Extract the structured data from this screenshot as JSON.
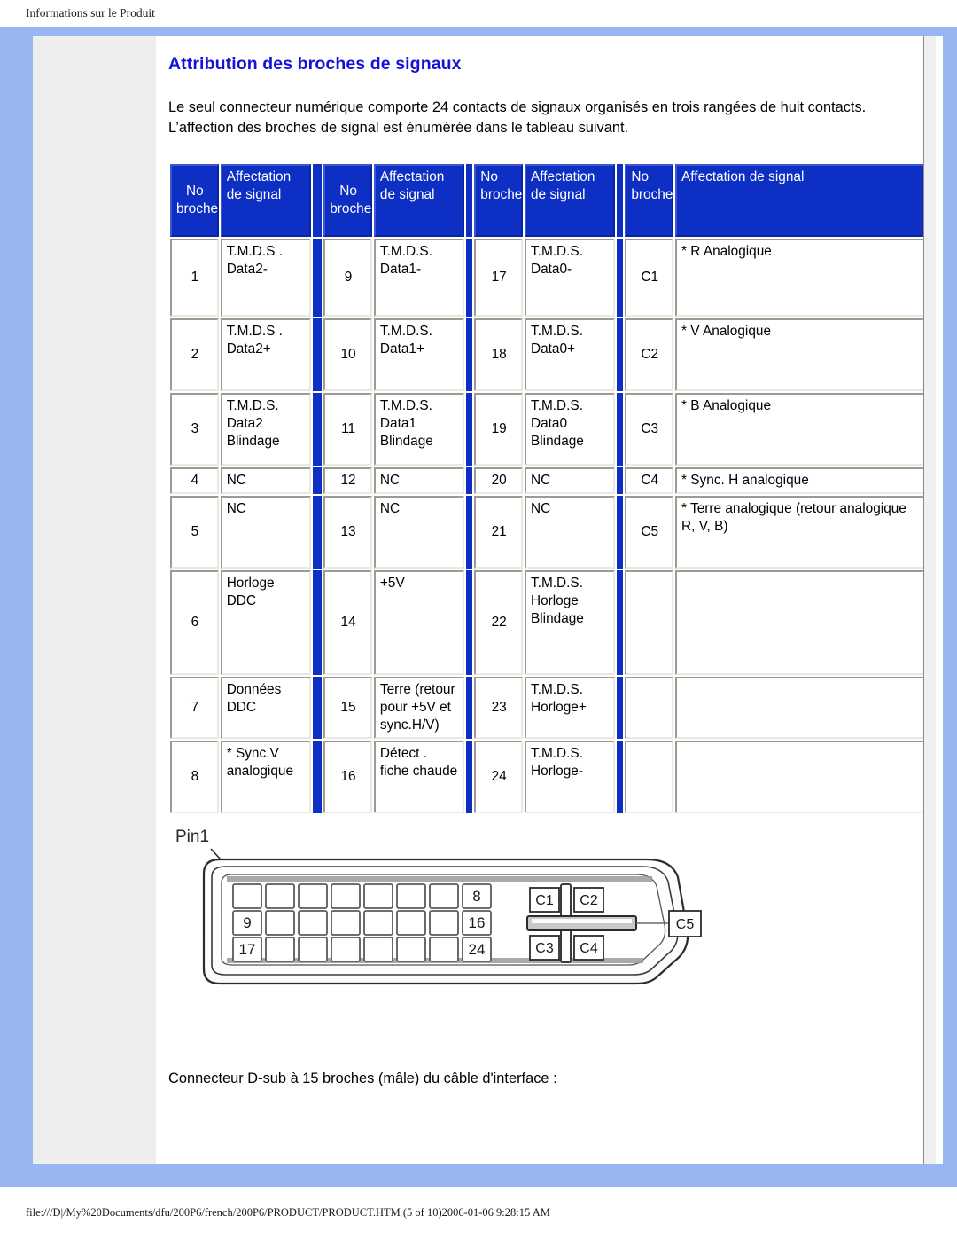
{
  "header": {
    "title": "Informations sur le Produit"
  },
  "page": {
    "section_title": "Attribution des broches de signaux",
    "intro": "Le seul connecteur numérique comporte 24 contacts de signaux organisés en trois rangées de huit contacts. L’affection des broches de signal est énumérée dans le tableau suivant.",
    "caption": "Connecteur D-sub à 15 broches (mâle) du câble d'interface :"
  },
  "colors": {
    "frame_blue": "#97b6f2",
    "header_blue": "#0d2fc4",
    "title_blue": "#1313d8",
    "sidebar_gray": "#eeeeee"
  },
  "table": {
    "headers": {
      "no1": "No broche.",
      "sig1": "Affectation de signal",
      "no2": "No broche",
      "sig2": "Affectation de signal",
      "no3": "No broche",
      "sig3": "Affectation de signal",
      "no4": "No broche",
      "sig4": "Affectation de signal"
    },
    "rows": [
      {
        "n1": "1",
        "s1": "T.M.D.S . Data2-",
        "n2": "9",
        "s2": "T.M.D.S. Data1-",
        "n3": "17",
        "s3": "T.M.D.S. Data0-",
        "n4": "C1",
        "s4": "* R Analogique"
      },
      {
        "n1": "2",
        "s1": "T.M.D.S . Data2+",
        "n2": "10",
        "s2": "T.M.D.S. Data1+",
        "n3": "18",
        "s3": "T.M.D.S. Data0+",
        "n4": "C2",
        "s4": "* V Analogique"
      },
      {
        "n1": "3",
        "s1": "T.M.D.S. Data2 Blindage",
        "n2": "11",
        "s2": "T.M.D.S. Data1 Blindage",
        "n3": "19",
        "s3": "T.M.D.S. Data0 Blindage",
        "n4": "C3",
        "s4": "* B Analogique"
      },
      {
        "n1": "4",
        "s1": "NC",
        "n2": "12",
        "s2": "NC",
        "n3": "20",
        "s3": "NC",
        "n4": "C4",
        "s4": "* Sync. H analogique"
      },
      {
        "n1": "5",
        "s1": "NC",
        "n2": "13",
        "s2": "NC",
        "n3": "21",
        "s3": "NC",
        "n4": "C5",
        "s4": "* Terre analogique  (retour analogique R, V, B)"
      },
      {
        "n1": "6",
        "s1": "Horloge DDC",
        "n2": "14",
        "s2": "+5V",
        "n3": "22",
        "s3": "T.M.D.S. Horloge Blindage",
        "n4": "",
        "s4": ""
      },
      {
        "n1": "7",
        "s1": "Données DDC",
        "n2": "15",
        "s2": "Terre (retour pour +5V et sync.H/V)",
        "n3": "23",
        "s3": "T.M.D.S. Horloge+",
        "n4": "",
        "s4": ""
      },
      {
        "n1": "8",
        "s1": "* Sync.V analogique",
        "n2": "16",
        "s2": "Détect . fiche chaude",
        "n3": "24",
        "s3": "T.M.D.S. Horloge-",
        "n4": "",
        "s4": ""
      }
    ]
  },
  "connector": {
    "pin1_label": "Pin1",
    "row_labels": {
      "top": "8",
      "middle": "16",
      "bottom": "24"
    },
    "row_start_labels": {
      "middle": "9",
      "bottom": "17"
    },
    "cross_labels": {
      "c1": "C1",
      "c2": "C2",
      "c3": "C3",
      "c4": "C4",
      "c5": "C5"
    }
  },
  "footer": {
    "path": "file:///D|/My%20Documents/dfu/200P6/french/200P6/PRODUCT/PRODUCT.HTM (5 of 10)2006-01-06 9:28:15 AM"
  }
}
